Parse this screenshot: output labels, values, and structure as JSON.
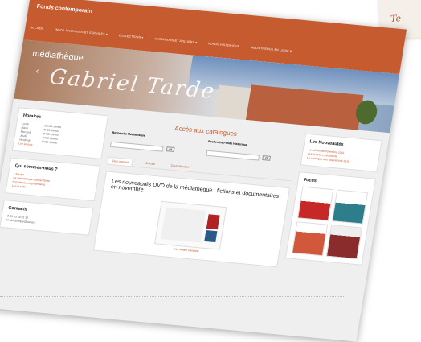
{
  "site_title": "Fonds contemporain",
  "corner_text": "Te",
  "nav": [
    "ACCUEIL",
    "INFOS PRATIQUES ET SERVICES ▾",
    "COLLECTIONS ▾",
    "ANIMATIONS ET ATELIERS ▾",
    "FONDS HISTORIQUE",
    "MEDIATHEQUE EN LIGNE ▾"
  ],
  "banner": {
    "line1": "médiathèque",
    "line2": "Gabriel Tarde",
    "arrow": "‹"
  },
  "horaires": {
    "title": "Horaires",
    "rows": [
      {
        "day": "Lundi",
        "time": "13H00-18H00"
      },
      {
        "day": "Mardi",
        "time": "9H00-18H00"
      },
      {
        "day": "Mercredi",
        "time": "9H00-18H00"
      },
      {
        "day": "Jeudi",
        "time": "9H00-18H00"
      },
      {
        "day": "Vendredi",
        "time": "9H00-18H00"
      }
    ],
    "more": "Lire la suite"
  },
  "qui": {
    "title": "Qui sommes-nous ?",
    "links": [
      "L'Equipe",
      "La médiathèque Gabriel Tarde",
      "Nos réseaux et partenaires"
    ],
    "more": "Lire la suite"
  },
  "contacts": {
    "title": "Contacts",
    "phone": "05 53 59 91 32",
    "email": "bibliotheque@sarlat.fr"
  },
  "center": {
    "title": "Accès aux catalogues",
    "search1_label": "Recherche Médiathèque",
    "search2_label": "Recherche Fonds Historique",
    "ok": "Ok",
    "tabs": [
      "Sites internet",
      "Articles",
      "Coup de cœur"
    ],
    "article_title": "Les nouveautés DVD de la médiathèque : fictions et documentaires en novembre",
    "close": "×",
    "more": "Voir la liste complète"
  },
  "nouveautes": {
    "title": "Les Nouveautés",
    "links": [
      "Le bulletin de novembre 2016",
      "Les bulletins précédents",
      "Le catalogue des acquisitions 2016"
    ]
  },
  "focus": {
    "title": "Focus"
  }
}
